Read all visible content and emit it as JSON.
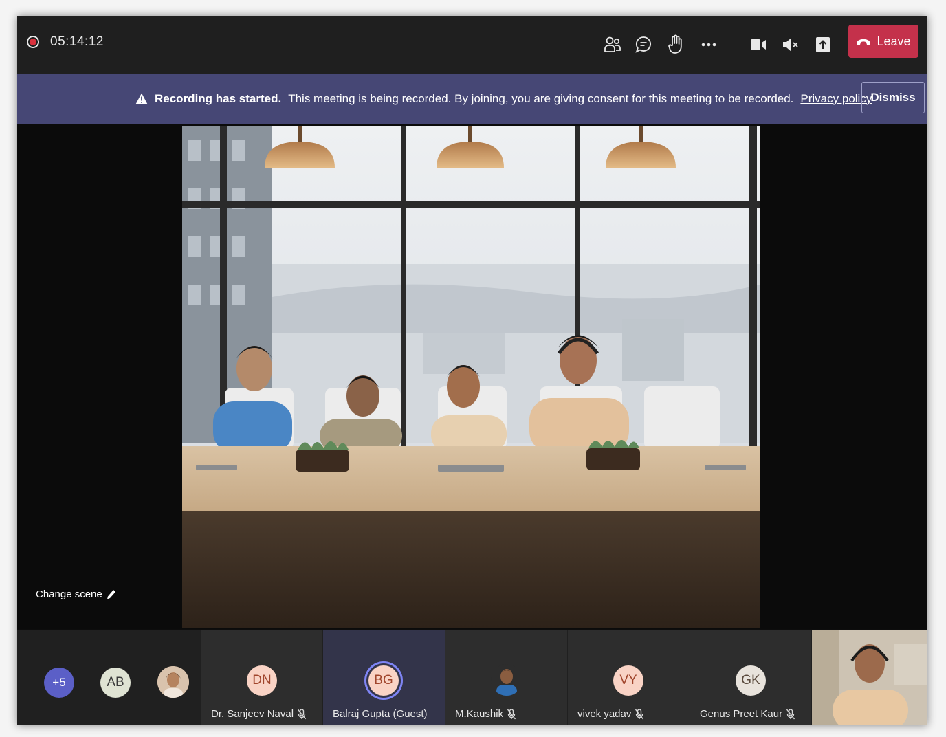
{
  "meeting": {
    "timer": "05:14:12",
    "leave_label": "Leave"
  },
  "toolbar_icons": [
    "participants-icon",
    "chat-icon",
    "raise-hand-icon",
    "more-options-icon",
    "camera-icon",
    "speaker-muted-icon",
    "share-screen-icon",
    "phone-hangup-icon"
  ],
  "banner": {
    "title": "Recording has started.",
    "message": "This meeting is being recorded. By joining, you are giving consent for this meeting to be recorded.",
    "link": "Privacy policy",
    "dismiss_label": "Dismiss"
  },
  "stage": {
    "change_scene_label": "Change scene"
  },
  "overflow": {
    "count_label": "+5"
  },
  "participants": [
    {
      "initials": "AB",
      "name": ""
    },
    {
      "initials": "DN",
      "name": "Dr. Sanjeev Naval"
    },
    {
      "initials": "BG",
      "name": "Balraj Gupta (Guest)"
    },
    {
      "initials": "",
      "name": "M.Kaushik"
    },
    {
      "initials": "VY",
      "name": "vivek yadav"
    },
    {
      "initials": "GK",
      "name": "Genus Preet Kaur"
    }
  ],
  "colors": {
    "leave": "#c4314b",
    "banner": "#464775",
    "overflow_avatar": "#5b5fc7",
    "initials_avatar": "#f9d3c5",
    "initials_text": "#a0452c",
    "ab_avatar": "#dfe3d3"
  }
}
